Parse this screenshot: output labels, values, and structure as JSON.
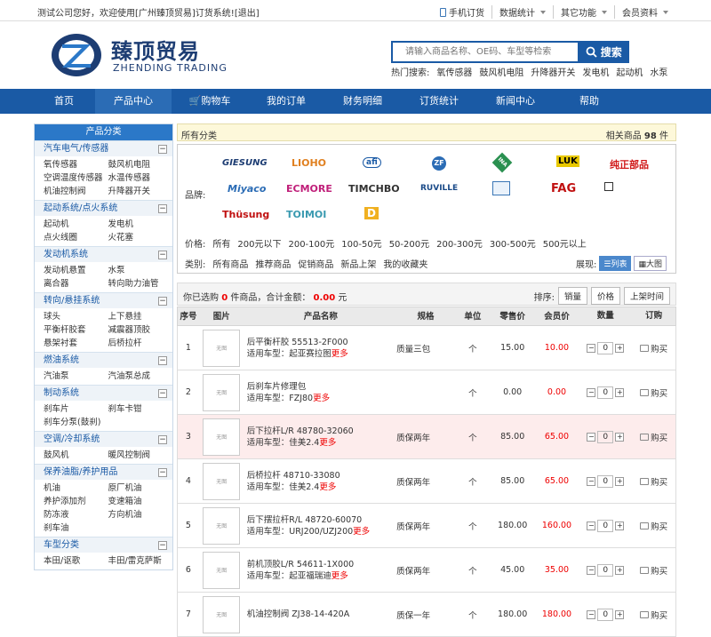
{
  "topbar": {
    "welcome": "测试公司您好，欢迎使用[广州臻顶贸易]订货系统!",
    "exit": "[退出]",
    "links": [
      "手机订货",
      "数据统计",
      "其它功能",
      "会员资料"
    ]
  },
  "logo": {
    "cn": "臻顶贸易",
    "en": "ZHENDING TRADING"
  },
  "search": {
    "placeholder": "请输入商品名称、OE码、车型等检索",
    "button": "搜索",
    "hot_label": "热门搜索:",
    "hot": [
      "氧传感器",
      "鼓风机电阻",
      "升降器开关",
      "发电机",
      "起动机",
      "水泵"
    ]
  },
  "nav": [
    "首页",
    "产品中心",
    "购物车",
    "我的订单",
    "财务明细",
    "订货统计",
    "新闻中心",
    "帮助"
  ],
  "sidebar": {
    "title": "产品分类",
    "cats": [
      {
        "name": "汽车电气/传感器",
        "items": [
          "氧传感器",
          "鼓风机电阻",
          "空调温度传感器",
          "水温传感器",
          "机油控制阀",
          "升降器开关"
        ]
      },
      {
        "name": "起动系统/点火系统",
        "items": [
          "起动机",
          "发电机",
          "点火线圈",
          "火花塞"
        ]
      },
      {
        "name": "发动机系统",
        "items": [
          "发动机悬置",
          "水泵",
          "离合器",
          "转向助力油管"
        ]
      },
      {
        "name": "转向/悬挂系统",
        "items": [
          "球头",
          "上下悬挂",
          "平衡杆胶套",
          "减震器顶胶",
          "悬架衬套",
          "后桥拉杆"
        ]
      },
      {
        "name": "燃油系统",
        "items": [
          "汽油泵",
          "汽油泵总成"
        ]
      },
      {
        "name": "制动系统",
        "items": [
          "刹车片",
          "刹车卡钳",
          "刹车分泵(鼓刹)"
        ]
      },
      {
        "name": "空调/冷却系统",
        "items": [
          "鼓风机",
          "暖风控制阀"
        ]
      },
      {
        "name": "保养油脂/养护用品",
        "items": [
          "机油",
          "原厂机油",
          "养护添加剂",
          "变速箱油",
          "防冻液",
          "方向机油",
          "刹车油"
        ]
      },
      {
        "name": "车型分类",
        "items": [
          "本田/讴歌",
          "丰田/雷克萨斯"
        ]
      }
    ]
  },
  "crumb": {
    "all": "所有分类",
    "count_label": "相关商品",
    "count": "98",
    "count_unit": "件"
  },
  "filter": {
    "brand_label": "品牌:",
    "brands": [
      "GIESUNG",
      "LIOHO",
      "afi",
      "ZF",
      "INA",
      "LUK",
      "纯正部品",
      "Miyaco",
      "ECMORE",
      "TIMCHBO",
      "RUVILLE",
      "",
      "FAG",
      "",
      "Thüsung",
      "TOIMOI",
      "D"
    ],
    "price_label": "价格:",
    "prices": [
      "所有",
      "200元以下",
      "200-100元",
      "100-50元",
      "50-200元",
      "200-300元",
      "300-500元",
      "500元以上"
    ],
    "type_label": "类别:",
    "types": [
      "所有商品",
      "推荐商品",
      "促销商品",
      "新品上架",
      "我的收藏夹"
    ],
    "view_label": "展现:",
    "view_list": "列表",
    "view_grid": "大图"
  },
  "summary": {
    "pre": "你已选购",
    "count": "0",
    "mid": "件商品，合计金额：",
    "amount": "0.00",
    "unit": "元",
    "sort_label": "排序:",
    "sorts": [
      "销量",
      "价格",
      "上架时间"
    ]
  },
  "table": {
    "headers": [
      "序号",
      "图片",
      "产品名称",
      "规格",
      "单位",
      "零售价",
      "会员价",
      "数量",
      "订购"
    ],
    "buy": "购买",
    "more": "更多",
    "model_label": "适用车型：",
    "rows": [
      {
        "no": "1",
        "name": "后平衡杆胶  55513-2F000",
        "model": "起亚赛拉图",
        "spec": "质量三包",
        "unit": "个",
        "price": "15.00",
        "member": "10.00",
        "qty": "0"
      },
      {
        "no": "2",
        "name": "后刹车片修理包",
        "model": "FZJ80",
        "spec": "",
        "unit": "个",
        "price": "0.00",
        "member": "0.00",
        "qty": "0"
      },
      {
        "no": "3",
        "name": "后下拉杆L/R 48780-32060",
        "model": "佳美2.4",
        "spec": "质保两年",
        "unit": "个",
        "price": "85.00",
        "member": "65.00",
        "qty": "0"
      },
      {
        "no": "4",
        "name": "后桥拉杆  48710-33080",
        "model": "佳美2.4",
        "spec": "质保两年",
        "unit": "个",
        "price": "85.00",
        "member": "65.00",
        "qty": "0"
      },
      {
        "no": "5",
        "name": "后下摆拉杆R/L 48720-60070",
        "model": "URJ200/UZJ200",
        "spec": "质保两年",
        "unit": "个",
        "price": "180.00",
        "member": "160.00",
        "qty": "0"
      },
      {
        "no": "6",
        "name": "前机顶胶L/R 54611-1X000",
        "model": "起亚福瑞迪",
        "spec": "质保两年",
        "unit": "个",
        "price": "45.00",
        "member": "35.00",
        "qty": "0"
      },
      {
        "no": "7",
        "name": "机油控制阀  ZJ38-14-420A",
        "model": "",
        "spec": "质保一年",
        "unit": "个",
        "price": "180.00",
        "member": "180.00",
        "qty": "0"
      }
    ]
  },
  "thumb_text": "无图"
}
